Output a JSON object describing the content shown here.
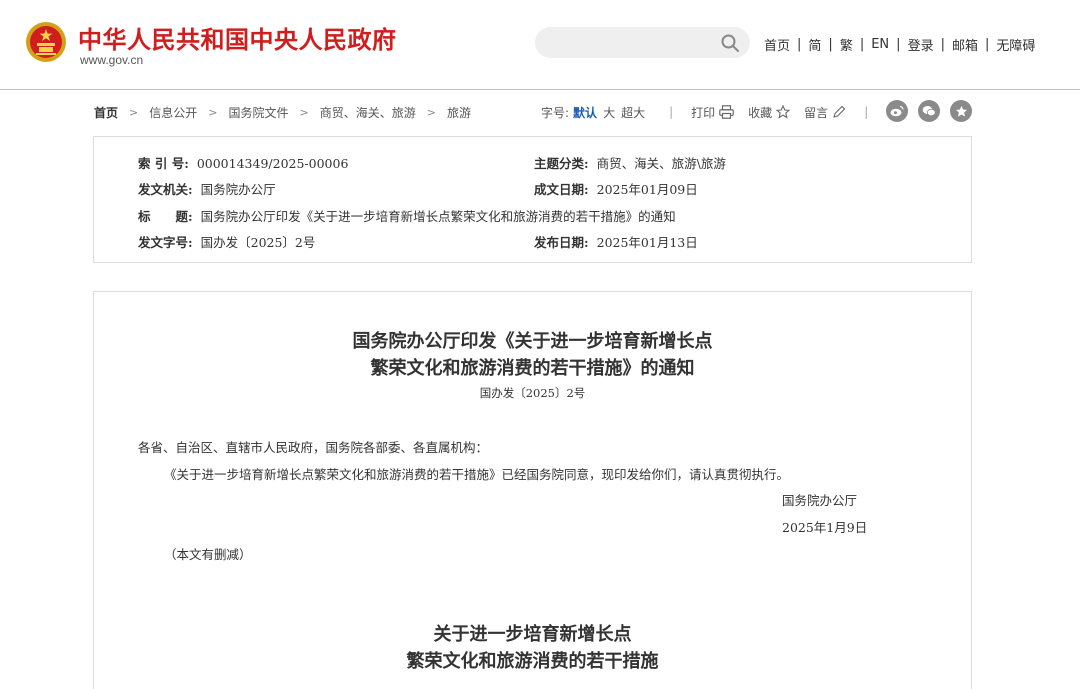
{
  "header": {
    "site_name": "中华人民共和国中央人民政府",
    "site_url": "www.gov.cn",
    "search_placeholder": "",
    "emblem_icon": "national-emblem-icon",
    "nav": [
      "首页",
      "简",
      "繁",
      "EN",
      "登录",
      "邮箱",
      "无障碍"
    ],
    "nav_sep": "|"
  },
  "breadcrumb": {
    "items": [
      "首页",
      "信息公开",
      "国务院文件",
      "商贸、海关、旅游",
      "旅游"
    ],
    "arrow": ">"
  },
  "toolbar": {
    "font_size_label": "字号:",
    "font_sizes": [
      "默认",
      "大",
      "超大"
    ],
    "active_font_size": "默认",
    "print_label": "打印",
    "favorite_label": "收藏",
    "comment_label": "留言",
    "divider": "|",
    "share_icons": [
      "weibo-icon",
      "wechat-icon",
      "star-icon"
    ]
  },
  "info": {
    "index_label": "索 引 号:",
    "index_value": "000014349/2025-00006",
    "category_label": "主题分类:",
    "category_value": "商贸、海关、旅游\\旅游",
    "issuer_label": "发文机关:",
    "issuer_value": "国务院办公厅",
    "written_date_label": "成文日期:",
    "written_date_value": "2025年01月09日",
    "title_label": "标　　题:",
    "title_value": "国务院办公厅印发《关于进一步培育新增长点繁荣文化和旅游消费的若干措施》的通知",
    "doc_number_label": "发文字号:",
    "doc_number_value": "国办发〔2025〕2号",
    "publish_date_label": "发布日期:",
    "publish_date_value": "2025年01月13日"
  },
  "document": {
    "title_line1": "国务院办公厅印发《关于进一步培育新增长点",
    "title_line2": "繁荣文化和旅游消费的若干措施》的通知",
    "doc_number": "国办发〔2025〕2号",
    "salutation": "各省、自治区、直辖市人民政府，国务院各部委、各直属机构：",
    "body": "《关于进一步培育新增长点繁荣文化和旅游消费的若干措施》已经国务院同意，现印发给你们，请认真贯彻执行。",
    "signer": "国务院办公厅",
    "date": "2025年1月9日",
    "note": "（本文有删减）",
    "sub_title_line1": "关于进一步培育新增长点",
    "sub_title_line2": "繁荣文化和旅游消费的若干措施"
  },
  "colors": {
    "brand_red": "#d01d1d",
    "active_blue": "#1a5fb4",
    "border": "#dcdcdc"
  }
}
